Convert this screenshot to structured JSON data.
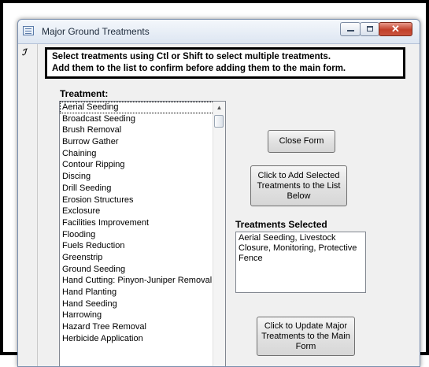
{
  "window": {
    "title": "Major Ground Treatments",
    "icon": "form-icon",
    "controls": {
      "minimize": "minimize-icon",
      "maximize": "maximize-icon",
      "close": "close-icon",
      "close_glyph": "✕"
    }
  },
  "record_selector": {
    "icon": "pencil-icon",
    "glyph": "ℐ"
  },
  "instructions": {
    "line1": "Select treatments using Ctl or Shift to select multiple treatments.",
    "line2": "Add them to the list to confirm before adding them to the main form."
  },
  "treatment_list": {
    "label": "Treatment:",
    "items": [
      "Aerial Seeding",
      "Broadcast Seeding",
      "Brush Removal",
      "Burrow Gather",
      "Chaining",
      "Contour Ripping",
      "Discing",
      "Drill Seeding",
      "Erosion Structures",
      "Exclosure",
      "Facilities Improvement",
      "Flooding",
      "Fuels Reduction",
      "Greenstrip",
      "Ground Seeding",
      "Hand Cutting: Pinyon-Juniper Removal",
      "Hand Planting",
      "Hand Seeding",
      "Harrowing",
      "Hazard Tree Removal",
      "Herbicide Application"
    ],
    "focused_item": "Aerial Seeding"
  },
  "buttons": {
    "close_form": "Close Form",
    "add_selected": "Click to Add Selected Treatments to the List Below",
    "update_main": "Click to Update Major Treatments to the Main Form"
  },
  "selected": {
    "label": "Treatments Selected",
    "value": "Aerial Seeding, Livestock Closure, Monitoring, Protective Fence"
  },
  "colors": {
    "frame_border": "#000000",
    "window_border": "#7a8fae",
    "close_button": "#c2402a",
    "form_background": "#f0f0f0"
  }
}
